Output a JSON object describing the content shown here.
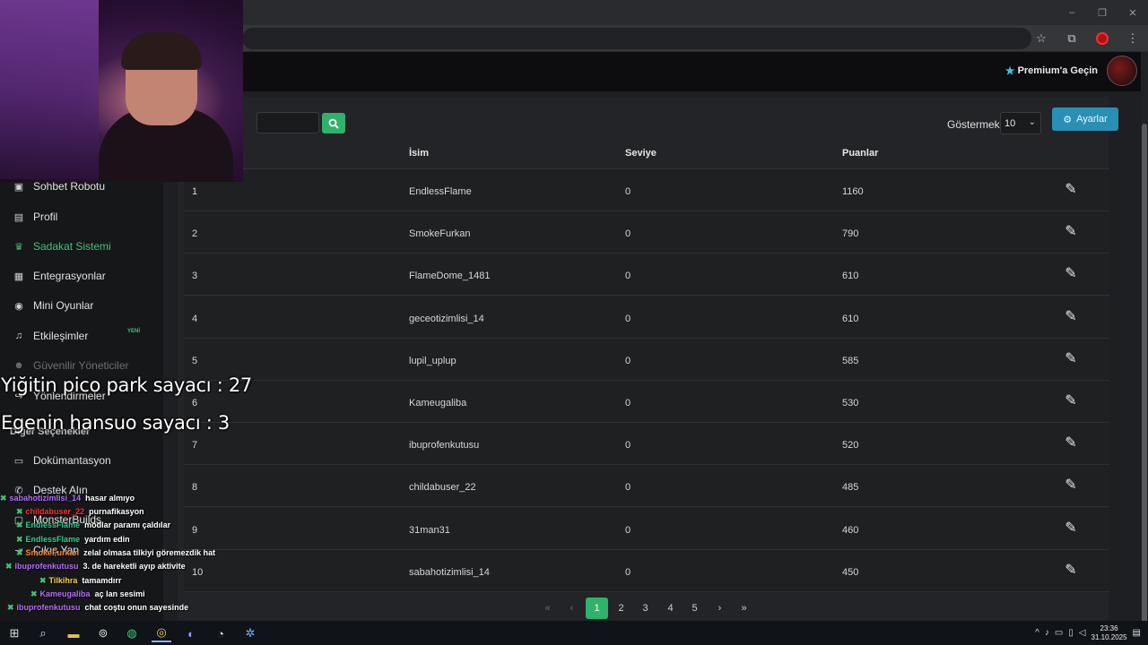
{
  "browser": {
    "window_controls": [
      "–",
      "❐",
      "✕"
    ],
    "addr_icons": [
      "star-icon",
      "extensions-icon",
      "profile-icon",
      "menu-icon"
    ]
  },
  "header": {
    "premium_label": "Premium'a Geçin"
  },
  "sidebar": {
    "items": [
      {
        "label": "Sohbet Robotu",
        "icon": "robot-icon"
      },
      {
        "label": "Profil",
        "icon": "id-card-icon"
      },
      {
        "label": "Sadakat Sistemi",
        "icon": "trophy-icon",
        "active": true
      },
      {
        "label": "Entegrasyonlar",
        "icon": "integration-icon"
      },
      {
        "label": "Mini Oyunlar",
        "icon": "gamepad-icon"
      },
      {
        "label": "Etkileşimler",
        "icon": "music-icon",
        "badge": "YENİ"
      },
      {
        "label": "Güvenilir Yöneticiler",
        "icon": "users-icon",
        "dim": true
      },
      {
        "label": "Yönlendirmeler",
        "icon": "redirect-icon"
      },
      {
        "label": "Dokümantasyon",
        "icon": "docs-icon"
      },
      {
        "label": "Destek Alın",
        "icon": "support-icon"
      },
      {
        "label": "MonsterBuilds",
        "icon": "monitor-icon"
      },
      {
        "label": "Çıkış Yap",
        "icon": "logout-icon"
      }
    ],
    "section_head": "Diğer Seçenekler"
  },
  "toolbar": {
    "show_label": "Göstermek:",
    "show_value": "10",
    "settings_label": "Ayarlar"
  },
  "table": {
    "headers": [
      "İsim",
      "Seviye",
      "Puanlar"
    ],
    "rows": [
      {
        "rank": "1",
        "name": "EndlessFlame",
        "level": "0",
        "points": "1160"
      },
      {
        "rank": "2",
        "name": "SmokeFurkan",
        "level": "0",
        "points": "790"
      },
      {
        "rank": "3",
        "name": "FlameDome_1481",
        "level": "0",
        "points": "610"
      },
      {
        "rank": "4",
        "name": "geceotizimlisi_14",
        "level": "0",
        "points": "610"
      },
      {
        "rank": "5",
        "name": "lupil_uplup",
        "level": "0",
        "points": "585"
      },
      {
        "rank": "6",
        "name": "Kameugaliba",
        "level": "0",
        "points": "530"
      },
      {
        "rank": "7",
        "name": "ibuprofenkutusu",
        "level": "0",
        "points": "520"
      },
      {
        "rank": "8",
        "name": "childabuser_22",
        "level": "0",
        "points": "485"
      },
      {
        "rank": "9",
        "name": "31man31",
        "level": "0",
        "points": "460"
      },
      {
        "rank": "10",
        "name": "sabahotizimlisi_14",
        "level": "0",
        "points": "450"
      }
    ]
  },
  "pagination": {
    "first": "«",
    "prev": "‹",
    "pages": [
      "1",
      "2",
      "3",
      "4",
      "5"
    ],
    "current": "1",
    "next": "›",
    "last": "»"
  },
  "overlay": {
    "counter1": "Yiğitin pico park sayacı : 27",
    "counter2": "Egenin hansuo sayacı : 3"
  },
  "chat": [
    {
      "user": "sabahotizimlisi_14",
      "color": "#b86bff",
      "msg": "hasar almıyo"
    },
    {
      "user": "childabuser_22",
      "color": "#ff3030",
      "msg": "purnafikasyon"
    },
    {
      "user": "EndlessFlame",
      "color": "#2fd38c",
      "msg": "modlar paramı çaldılar"
    },
    {
      "user": "EndlessFlame",
      "color": "#2fd38c",
      "msg": "yardım edin"
    },
    {
      "user": "SmokeFurkan",
      "color": "#ff8a2a",
      "msg": "zelal olmasa tilkiyi göremezdik hat"
    },
    {
      "user": "ibuprofenkutusu",
      "color": "#b86bff",
      "msg": "3. de hareketli ayıp aktivite"
    },
    {
      "user": "Tilkihra",
      "color": "#ffd23a",
      "msg": "tamamdırr"
    },
    {
      "user": "Kameugaliba",
      "color": "#b86bff",
      "msg": "aç lan sesimi"
    },
    {
      "user": "ibuprofenkutusu",
      "color": "#b86bff",
      "msg": "chat coştu onun sayesinde"
    }
  ],
  "taskbar": {
    "time": "23:36",
    "date": "31.10.2025"
  }
}
